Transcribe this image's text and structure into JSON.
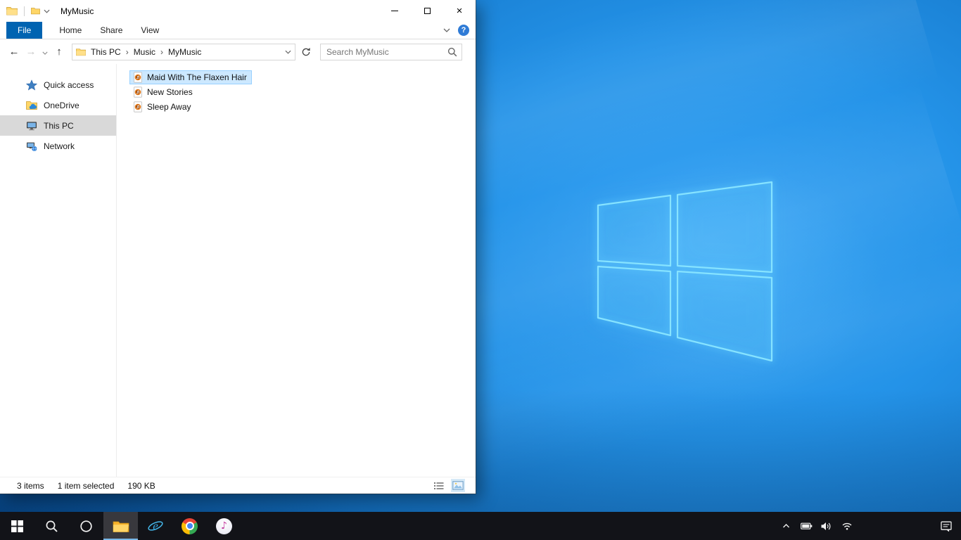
{
  "window": {
    "title": "MyMusic",
    "icons": {
      "close": "×",
      "help": "?",
      "crumb_separator": "›"
    },
    "ribbon": {
      "tabs": [
        {
          "label": "File",
          "active": true
        },
        {
          "label": "Home",
          "active": false
        },
        {
          "label": "Share",
          "active": false
        },
        {
          "label": "View",
          "active": false
        }
      ]
    },
    "address": {
      "breadcrumb": [
        "This PC",
        "Music",
        "MyMusic"
      ]
    },
    "search": {
      "placeholder": "Search MyMusic"
    },
    "sidebar": {
      "items": [
        {
          "label": "Quick access",
          "icon": "star-icon",
          "selected": false
        },
        {
          "label": "OneDrive",
          "icon": "onedrive-icon",
          "selected": false
        },
        {
          "label": "This PC",
          "icon": "this-pc-icon",
          "selected": true
        },
        {
          "label": "Network",
          "icon": "network-icon",
          "selected": false
        }
      ]
    },
    "files": [
      {
        "name": "Maid With The Flaxen Hair",
        "icon": "audio-file-icon",
        "selected": true
      },
      {
        "name": "New Stories",
        "icon": "audio-file-icon",
        "selected": false
      },
      {
        "name": "Sleep Away",
        "icon": "audio-file-icon",
        "selected": false
      }
    ],
    "status": {
      "count": "3 items",
      "selection": "1 item selected",
      "size": "190 KB"
    }
  },
  "taskbar": {
    "buttons": [
      "start",
      "search",
      "cortana",
      "file-explorer",
      "internet-explorer",
      "chrome",
      "itunes"
    ],
    "active_button": "file-explorer",
    "tray": [
      "tray-expand",
      "battery",
      "volume",
      "network",
      "action-center"
    ],
    "note_glyph": "♪"
  },
  "colors": {
    "accent_blue": "#0063b1",
    "selection_bg": "#cce8ff",
    "selection_border": "#99d1ff",
    "sidebar_selected": "#d9d9d9",
    "taskbar_bg": "#121318"
  }
}
